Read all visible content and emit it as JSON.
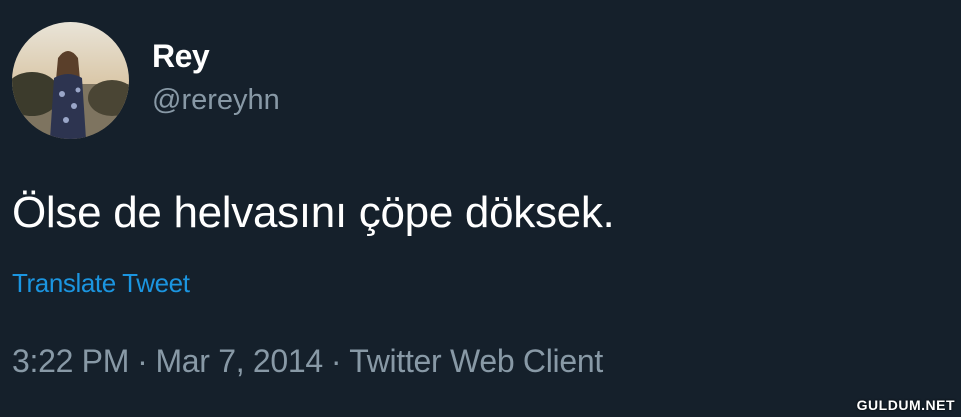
{
  "author": {
    "display_name": "Rey",
    "handle": "@rereyhn",
    "avatar_icon": "profile-photo-avatar"
  },
  "tweet": {
    "text": "Ölse de helvasını çöpe döksek.",
    "translate_label": "Translate Tweet"
  },
  "meta": {
    "time": "3:22 PM",
    "separator": "·",
    "date": "Mar 7, 2014",
    "source": "Twitter Web Client"
  },
  "watermark": "GULDUM.NET",
  "colors": {
    "background": "#15202b",
    "primary_text": "#ffffff",
    "secondary_text": "#8899a6",
    "link": "#1b95e0"
  }
}
